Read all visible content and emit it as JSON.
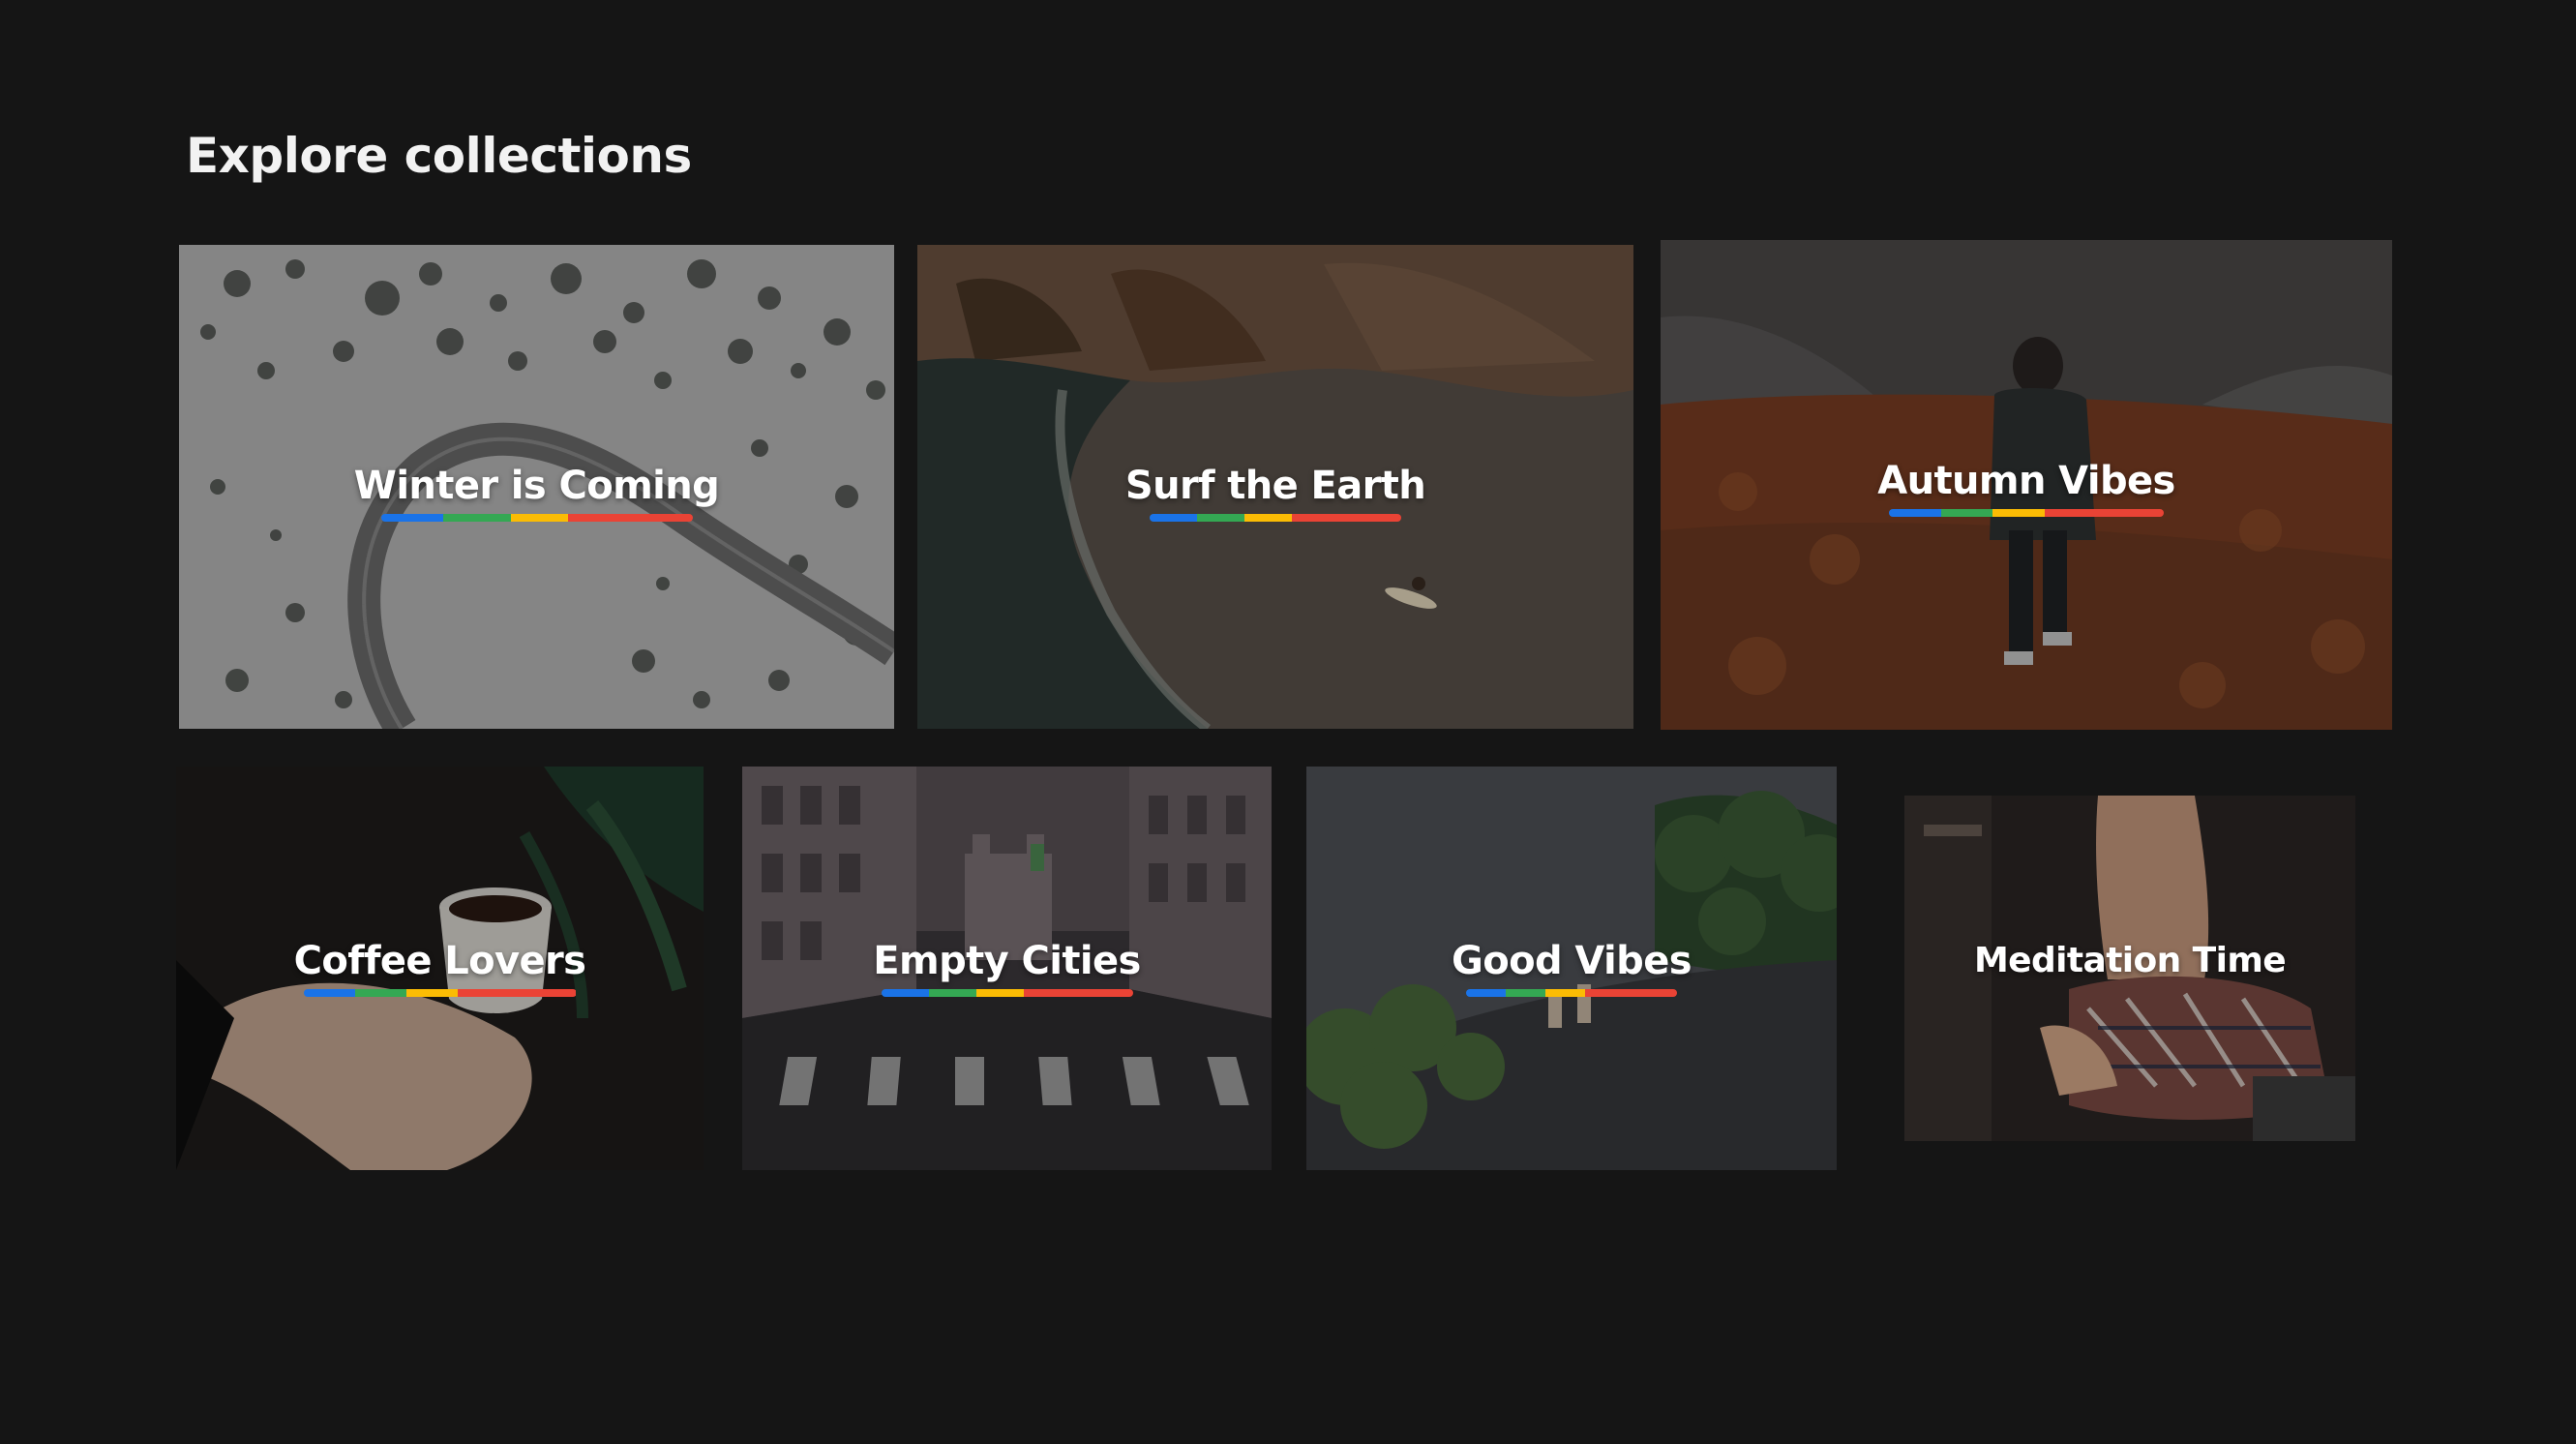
{
  "page": {
    "title": "Explore collections"
  },
  "stripe_colors": [
    "#1a73e8",
    "#34a853",
    "#fbbc04",
    "#ea4335",
    "#ea4335"
  ],
  "collections": [
    {
      "name": "Winter is Coming",
      "scene": "snowy-road"
    },
    {
      "name": "Surf the Earth",
      "scene": "beach-surfer"
    },
    {
      "name": "Autumn Vibes",
      "scene": "autumn-hiker"
    },
    {
      "name": "Coffee Lovers",
      "scene": "coffee-cup"
    },
    {
      "name": "Empty Cities",
      "scene": "empty-street"
    },
    {
      "name": "Good Vibes",
      "scene": "skater-road"
    },
    {
      "name": "Meditation Time",
      "scene": "meditation"
    }
  ]
}
